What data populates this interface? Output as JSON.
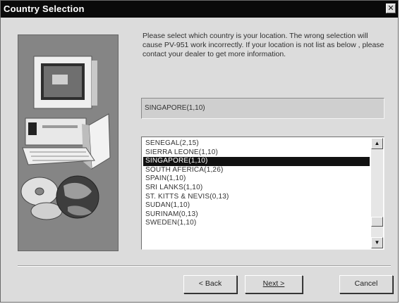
{
  "window": {
    "title": "Country Selection",
    "close_glyph": "✕"
  },
  "message": "Please select which country is your location. The wrong selection will cause PV-951 work incorrectly. If your location is not list as below , please contact your dealer to get more information.",
  "selected_field": "SINGAPORE(1,10)",
  "country_list": {
    "items": [
      "SENEGAL(2,15)",
      "SIERRA LEONE(1,10)",
      "SINGAPORE(1,10)",
      "SOUTH AFERICA(1,26)",
      "SPAIN(1,10)",
      "SRI LANKS(1,10)",
      "ST. KITTS & NEVIS(0,13)",
      "SUDAN(1,10)",
      "SURINAM(0,13)",
      "SWEDEN(1,10)"
    ],
    "selected_index": 2
  },
  "buttons": {
    "back": "< Back",
    "next": "Next >",
    "cancel": "Cancel"
  },
  "icons": {
    "illustration": "computer-with-cd-and-globe-icon",
    "close": "close-icon",
    "scroll_up": "scroll-up-arrow-icon",
    "scroll_down": "scroll-down-arrow-icon"
  },
  "colors": {
    "titlebar": "#0a0a0a",
    "dialog_bg": "#dcdcdc",
    "selection": "#111111"
  }
}
